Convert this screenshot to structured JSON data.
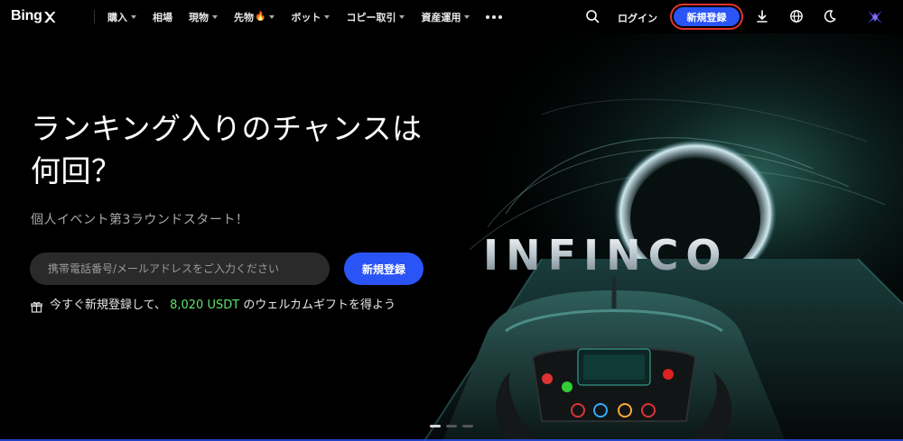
{
  "brand": {
    "logo_text": "Bing",
    "accent": "#2b54f6",
    "highlight_outline": "#e5322d",
    "bonus_color": "#5fe36a"
  },
  "nav": {
    "items": [
      {
        "label": "購入",
        "dropdown": true
      },
      {
        "label": "相場",
        "dropdown": false
      },
      {
        "label": "現物",
        "dropdown": true
      },
      {
        "label": "先物",
        "dropdown": true,
        "badge": "🔥"
      },
      {
        "label": "ボット",
        "dropdown": true
      },
      {
        "label": "コピー取引",
        "dropdown": true
      },
      {
        "label": "資産運用",
        "dropdown": true
      }
    ],
    "more_icon": "more-dots-icon"
  },
  "header": {
    "search_icon": "search-icon",
    "login_label": "ログイン",
    "signup_label": "新規登録",
    "download_icon": "download-icon",
    "language_icon": "globe-icon",
    "theme_icon": "moon-icon",
    "avatar_icon": "avatar-icon"
  },
  "hero": {
    "headline": "ランキング入りのチャンスは何回？",
    "subhead": "個人イベント第3ラウンドスタート！",
    "input_placeholder": "携帯電話番号/メールアドレスをご入力ください",
    "input_value": "",
    "signup_label": "新規登録",
    "gift_icon": "gift-icon",
    "gift_prefix": "今すぐ新規登録して、",
    "gift_amount": "8,020 USDT",
    "gift_suffix": "のウェルカムギフトを得よう",
    "banner_wordmark": "INFINCO",
    "carousel": {
      "total": 3,
      "active": 1
    }
  }
}
